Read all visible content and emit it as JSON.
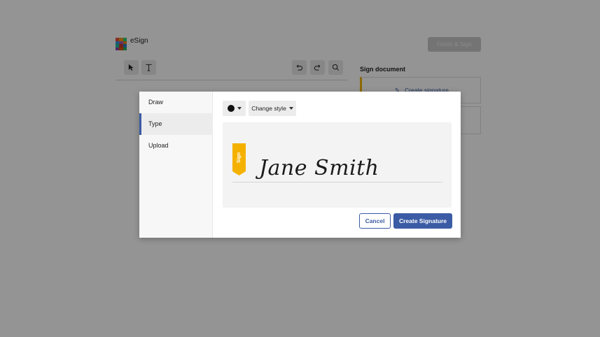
{
  "app": {
    "title": "eSign",
    "finish_button": "Finish & Sign",
    "sidebar": {
      "title": "Sign document",
      "create_link": "Create signature"
    }
  },
  "modal": {
    "tabs": [
      {
        "label": "Draw",
        "active": false
      },
      {
        "label": "Type",
        "active": true
      },
      {
        "label": "Upload",
        "active": false
      }
    ],
    "color_swatch": "#111111",
    "style_dropdown": "Change style",
    "signature": {
      "flag_label": "Sign",
      "flag_color": "#f5b100",
      "name": "Jane Smith"
    },
    "buttons": {
      "cancel": "Cancel",
      "create": "Create Signature"
    },
    "accent_color": "#3b5ba5"
  },
  "icons": [
    "pointer-icon",
    "text-tool-icon",
    "undo-icon",
    "redo-icon",
    "search-icon",
    "pen-icon",
    "caret-down-icon"
  ]
}
